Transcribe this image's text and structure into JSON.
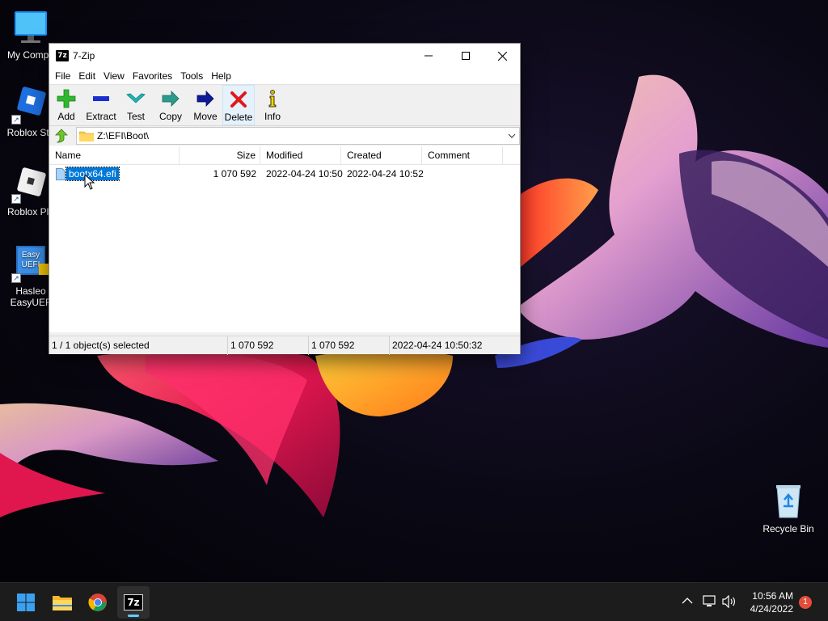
{
  "desktop": {
    "icons": [
      {
        "label": "My Compu"
      },
      {
        "label": "Roblox Stu"
      },
      {
        "label": "Roblox Pla"
      },
      {
        "label_line1": "Hasleo",
        "label_line2": "EasyUEF",
        "icon_text_line1": "Easy",
        "icon_text_line2": "UEFI"
      },
      {
        "label": "Recycle Bin"
      }
    ]
  },
  "window": {
    "title": "7-Zip",
    "app_icon_text": "7z",
    "menu": [
      "File",
      "Edit",
      "View",
      "Favorites",
      "Tools",
      "Help"
    ],
    "toolbar": [
      "Add",
      "Extract",
      "Test",
      "Copy",
      "Move",
      "Delete",
      "Info"
    ],
    "path": "Z:\\EFI\\Boot\\",
    "columns": [
      "Name",
      "Size",
      "Modified",
      "Created",
      "Comment"
    ],
    "files": [
      {
        "name": "bootx64.efi",
        "size": "1 070 592",
        "modified": "2022-04-24 10:50",
        "created": "2022-04-24 10:52",
        "comment": ""
      }
    ],
    "status": {
      "selection": "1 / 1 object(s) selected",
      "size": "1 070 592",
      "packed": "1 070 592",
      "datetime": "2022-04-24 10:50:32"
    }
  },
  "taskbar": {
    "apps": [
      "start-button",
      "file-explorer",
      "chrome",
      "7-zip"
    ],
    "active_app_label": "7z",
    "time": "10:56 AM",
    "date": "4/24/2022",
    "notification_count": "1"
  },
  "colors": {
    "selection": "#0078d7",
    "taskbar": "#1c1c1c",
    "accent": "#60cdff"
  }
}
